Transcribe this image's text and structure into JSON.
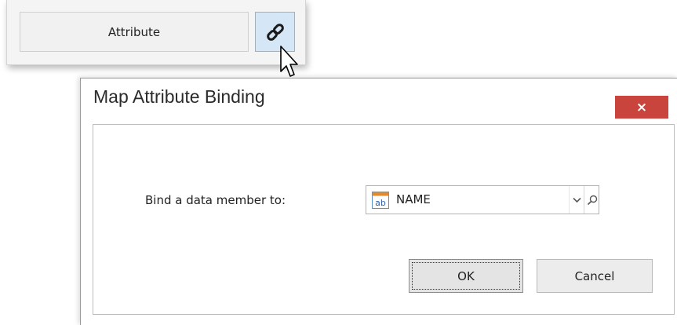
{
  "attribute_panel": {
    "attribute_label": "Attribute",
    "bind_button_icon": "link-icon"
  },
  "dialog": {
    "title": "Map Attribute Binding",
    "close_label": "×",
    "bind_label": "Bind a data member to:",
    "member": {
      "icon": "string-field-icon",
      "icon_text": "ab",
      "value": "NAME"
    },
    "ok_label": "OK",
    "cancel_label": "Cancel"
  },
  "colors": {
    "close_button": "#c9443c",
    "link_button_active": "#d5e6f7",
    "member_icon_accent": "#e08b2f"
  }
}
